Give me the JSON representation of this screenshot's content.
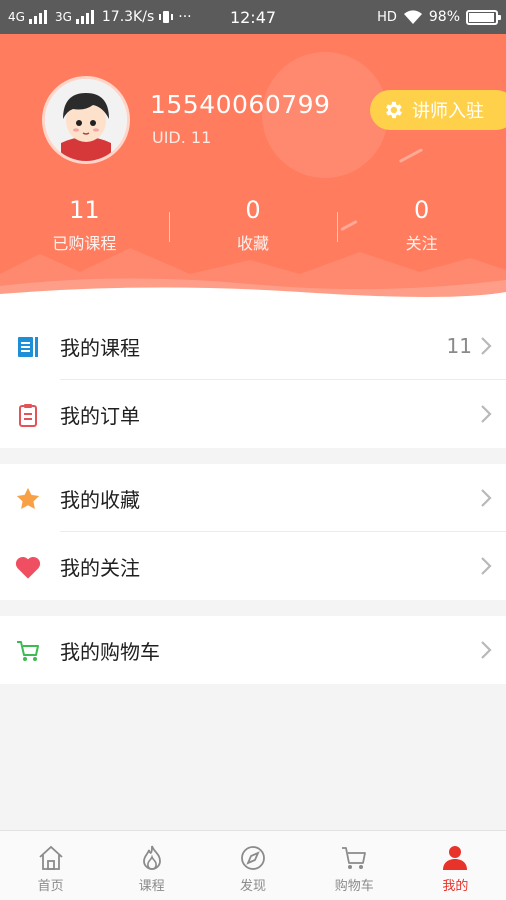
{
  "status_bar": {
    "net1": "4G",
    "net2": "3G",
    "speed": "17.3K/s",
    "more": "···",
    "time": "12:47",
    "hd": "HD",
    "battery": "98%"
  },
  "profile": {
    "phone": "15540060799",
    "uid": "UID. 11",
    "teacher_button": "讲师入驻"
  },
  "stats": [
    {
      "value": "11",
      "label": "已购课程"
    },
    {
      "value": "0",
      "label": "收藏"
    },
    {
      "value": "0",
      "label": "关注"
    }
  ],
  "menu": {
    "my_courses": {
      "label": "我的课程",
      "count": "11"
    },
    "my_orders": {
      "label": "我的订单"
    },
    "my_favorites": {
      "label": "我的收藏"
    },
    "my_follows": {
      "label": "我的关注"
    },
    "my_cart": {
      "label": "我的购物车"
    }
  },
  "tabs": [
    {
      "label": "首页",
      "icon": "home-icon"
    },
    {
      "label": "课程",
      "icon": "flame-icon"
    },
    {
      "label": "发现",
      "icon": "compass-icon"
    },
    {
      "label": "购物车",
      "icon": "cart-icon"
    },
    {
      "label": "我的",
      "icon": "person-icon",
      "active": true
    }
  ],
  "colors": {
    "header": "#ff7c5e",
    "teacher_button": "#ffd14a",
    "active_tab": "#e8332a",
    "courses_icon": "#1e8fd6",
    "orders_icon": "#e2545a",
    "favorites_icon": "#f7a046",
    "follows_icon": "#ef4f60",
    "cart_icon": "#3dbb52"
  }
}
